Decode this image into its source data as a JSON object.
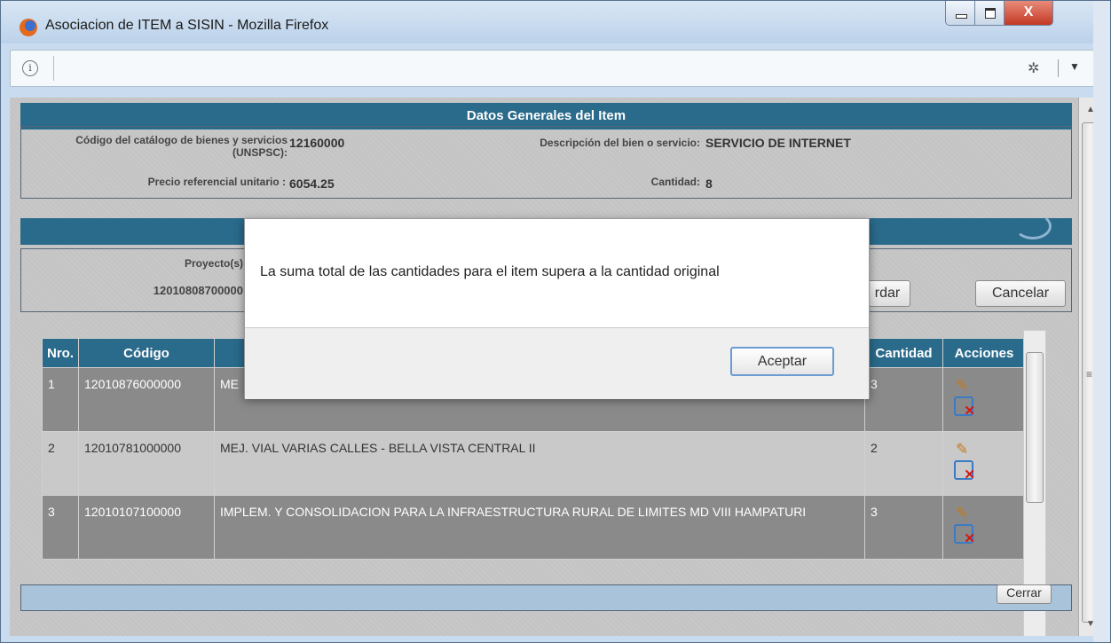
{
  "window": {
    "title": "Asociacion de ITEM a SISIN - Mozilla Firefox",
    "controls": {
      "close": "X"
    }
  },
  "urlbar": {
    "value": ""
  },
  "datos": {
    "header": "Datos Generales del Item",
    "codigo_label": "Código del catálogo de bienes y servicios (UNSPSC):",
    "codigo_value": "12160000",
    "descripcion_label": "Descripción del bien o servicio:",
    "descripcion_value": "SERVICIO DE INTERNET",
    "precio_label": "Precio referencial unitario :",
    "precio_value": "6054.25",
    "cantidad_label": "Cantidad:",
    "cantidad_value": "8"
  },
  "proyecto": {
    "label": "Proyecto(s)",
    "value": "12010808700000",
    "guardar_label": "rdar",
    "cancelar_label": "Cancelar"
  },
  "grid": {
    "columns": [
      "Nro.",
      "Código",
      "",
      "Cantidad",
      "Acciones"
    ],
    "rows": [
      {
        "nro": "1",
        "codigo": "12010876000000",
        "nombre": "ME",
        "cantidad": "3"
      },
      {
        "nro": "2",
        "codigo": "12010781000000",
        "nombre": "MEJ. VIAL VARIAS CALLES - BELLA VISTA CENTRAL II",
        "cantidad": "2"
      },
      {
        "nro": "3",
        "codigo": "12010107100000",
        "nombre": "IMPLEM. Y CONSOLIDACION PARA LA INFRAESTRUCTURA RURAL DE LIMITES MD VIII HAMPATURI",
        "cantidad": "3"
      }
    ]
  },
  "footer": {
    "cerrar_label": "Cerrar"
  },
  "dialog": {
    "message": "La suma total de las cantidades para el item supera a la cantidad original",
    "ok_label": "Aceptar"
  },
  "colors": {
    "header_bg": "#2a6a8a",
    "odd_row": "#8a8a8a",
    "even_row": "#c9c9c9"
  }
}
